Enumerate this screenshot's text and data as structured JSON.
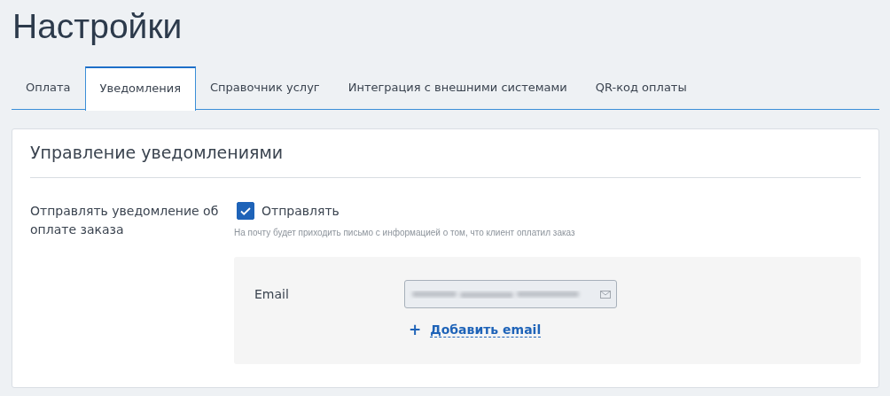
{
  "page_title": "Настройки",
  "tabs": [
    {
      "label": "Оплата",
      "selected": false
    },
    {
      "label": "Уведомления",
      "selected": true
    },
    {
      "label": "Справочник услуг",
      "selected": false
    },
    {
      "label": "Интеграция с внешними системами",
      "selected": false
    },
    {
      "label": "QR-код оплаты",
      "selected": false
    }
  ],
  "section": {
    "title": "Управление уведомлениями",
    "setting": {
      "label": "Отправлять уведомление об оплате заказа",
      "checkbox": {
        "label": "Отправлять",
        "checked": true
      },
      "hint": "На почту будет приходить письмо с информацией о том, что клиент оплатил заказ"
    },
    "email_panel": {
      "field_label": "Email",
      "email_field": {
        "redacted": true
      },
      "add_link": {
        "icon": "+",
        "label": "Добавить email"
      }
    }
  }
}
